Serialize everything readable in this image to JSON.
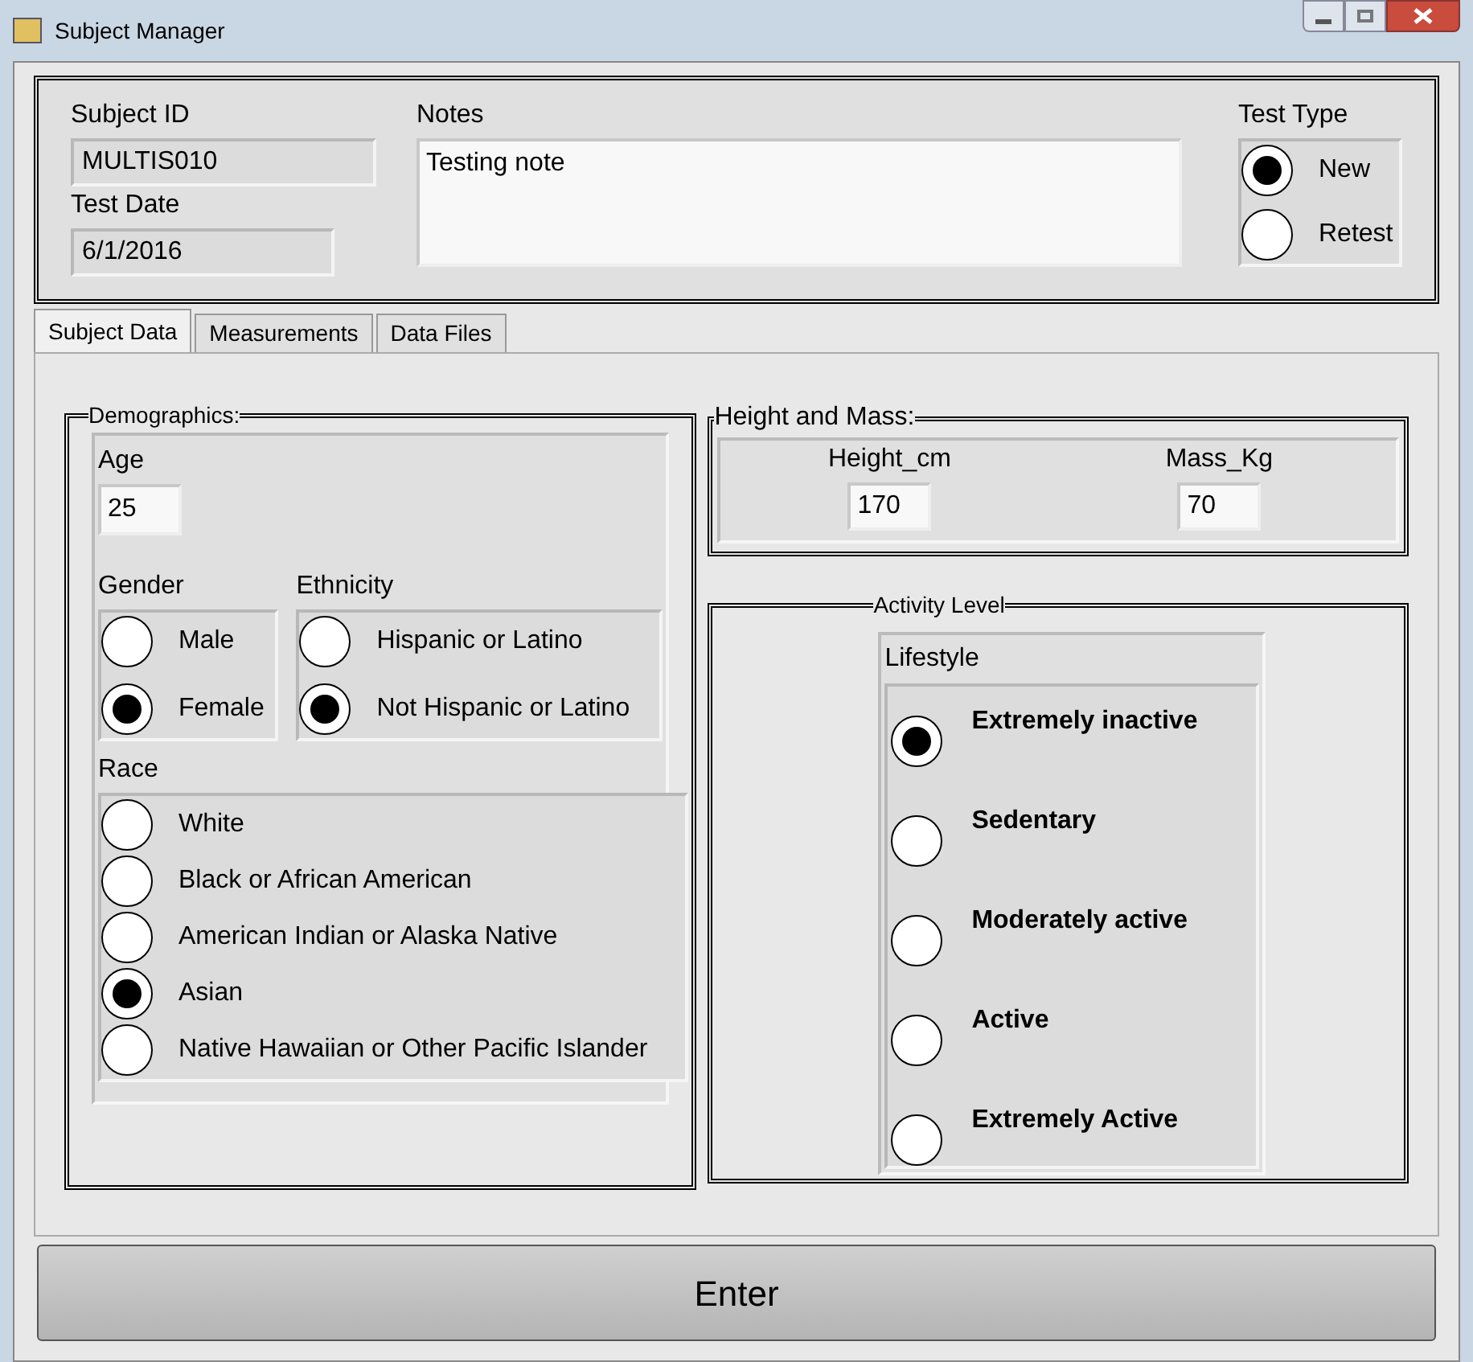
{
  "window": {
    "title": "Subject Manager"
  },
  "header": {
    "subject_id": {
      "label": "Subject ID",
      "value": "MULTIS010"
    },
    "test_date": {
      "label": "Test Date",
      "value": "6/1/2016"
    },
    "notes": {
      "label": "Notes",
      "value": "Testing note"
    },
    "test_type": {
      "label": "Test Type",
      "options": [
        {
          "label": "New",
          "selected": true
        },
        {
          "label": "Retest",
          "selected": false
        }
      ]
    }
  },
  "tabs": [
    {
      "label": "Subject Data",
      "selected": true
    },
    {
      "label": "Measurements",
      "selected": false
    },
    {
      "label": "Data Files",
      "selected": false
    }
  ],
  "demographics": {
    "title": "Demographics:",
    "age": {
      "label": "Age",
      "value": "25"
    },
    "gender": {
      "label": "Gender",
      "options": [
        {
          "label": "Male",
          "selected": false
        },
        {
          "label": "Female",
          "selected": true
        }
      ]
    },
    "ethnicity": {
      "label": "Ethnicity",
      "options": [
        {
          "label": "Hispanic or Latino",
          "selected": false
        },
        {
          "label": "Not Hispanic or Latino",
          "selected": true
        }
      ]
    },
    "race": {
      "label": "Race",
      "options": [
        {
          "label": "White",
          "selected": false
        },
        {
          "label": "Black or African American",
          "selected": false
        },
        {
          "label": "American Indian or Alaska Native",
          "selected": false
        },
        {
          "label": "Asian",
          "selected": true
        },
        {
          "label": "Native Hawaiian or Other Pacific Islander",
          "selected": false
        }
      ]
    }
  },
  "height_mass": {
    "title": "Height and Mass:",
    "height": {
      "label": "Height_cm",
      "value": "170"
    },
    "mass": {
      "label": "Mass_Kg",
      "value": "70"
    }
  },
  "activity": {
    "title": "Activity Level",
    "lifestyle": {
      "label": "Lifestyle",
      "options": [
        {
          "label": "Extremely inactive",
          "selected": true
        },
        {
          "label": "Sedentary",
          "selected": false
        },
        {
          "label": "Moderately active",
          "selected": false
        },
        {
          "label": "Active",
          "selected": false
        },
        {
          "label": "Extremely Active",
          "selected": false
        }
      ]
    }
  },
  "enter_button": {
    "label": "Enter"
  }
}
